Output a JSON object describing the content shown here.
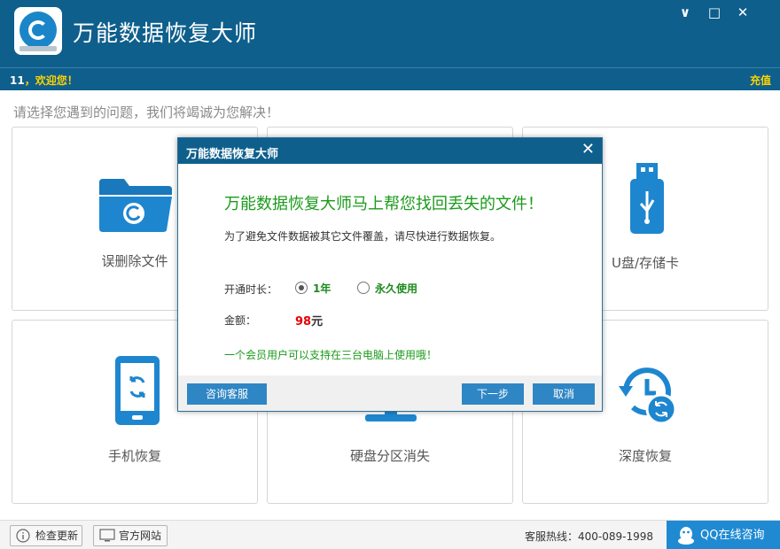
{
  "app": {
    "title": "万能数据恢复大师",
    "window_controls": [
      "∨",
      "□",
      "✕"
    ]
  },
  "welcome": {
    "user": "11",
    "greeting": "，欢迎您！",
    "recharge": "充值"
  },
  "main": {
    "prompt": "请选择您遇到的问题，我们将竭诚为您解决！",
    "cards": [
      {
        "label": "误删除文件",
        "icon": "folder-restore-icon"
      },
      {
        "label": "",
        "icon": ""
      },
      {
        "label": "U盘/存储卡",
        "icon": "usb-drive-icon"
      },
      {
        "label": "手机恢复",
        "icon": "phone-restore-icon"
      },
      {
        "label": "硬盘分区消失",
        "icon": "monitor-icon"
      },
      {
        "label": "深度恢复",
        "icon": "clock-restore-icon"
      }
    ]
  },
  "footer": {
    "check_update": "检查更新",
    "official_site": "官方网站",
    "hotline": "客服热线：400-089-1998",
    "qq": "QQ在线咨询"
  },
  "dialog": {
    "title": "万能数据恢复大师",
    "close": "✕",
    "headline": "万能数据恢复大师马上帮您找回丢失的文件！",
    "note": "为了避免文件数据被其它文件覆盖，请尽快进行数据恢复。",
    "duration_label": "开通时长：",
    "options": [
      {
        "label": "1年",
        "selected": true
      },
      {
        "label": "永久使用",
        "selected": false
      }
    ],
    "amount_label": "金额：",
    "amount_value": "98",
    "amount_unit": "元",
    "tip": "一个会员用户可以支持在三台电脑上使用哦！",
    "consult_button": "咨询客服",
    "next_button": "下一步",
    "cancel_button": "取消"
  },
  "colors": {
    "header": "#0e5f8c",
    "accent": "#1a86c8",
    "green_text": "#1b9b1b",
    "price_red": "#e60000",
    "button_blue": "#2f86c4"
  }
}
